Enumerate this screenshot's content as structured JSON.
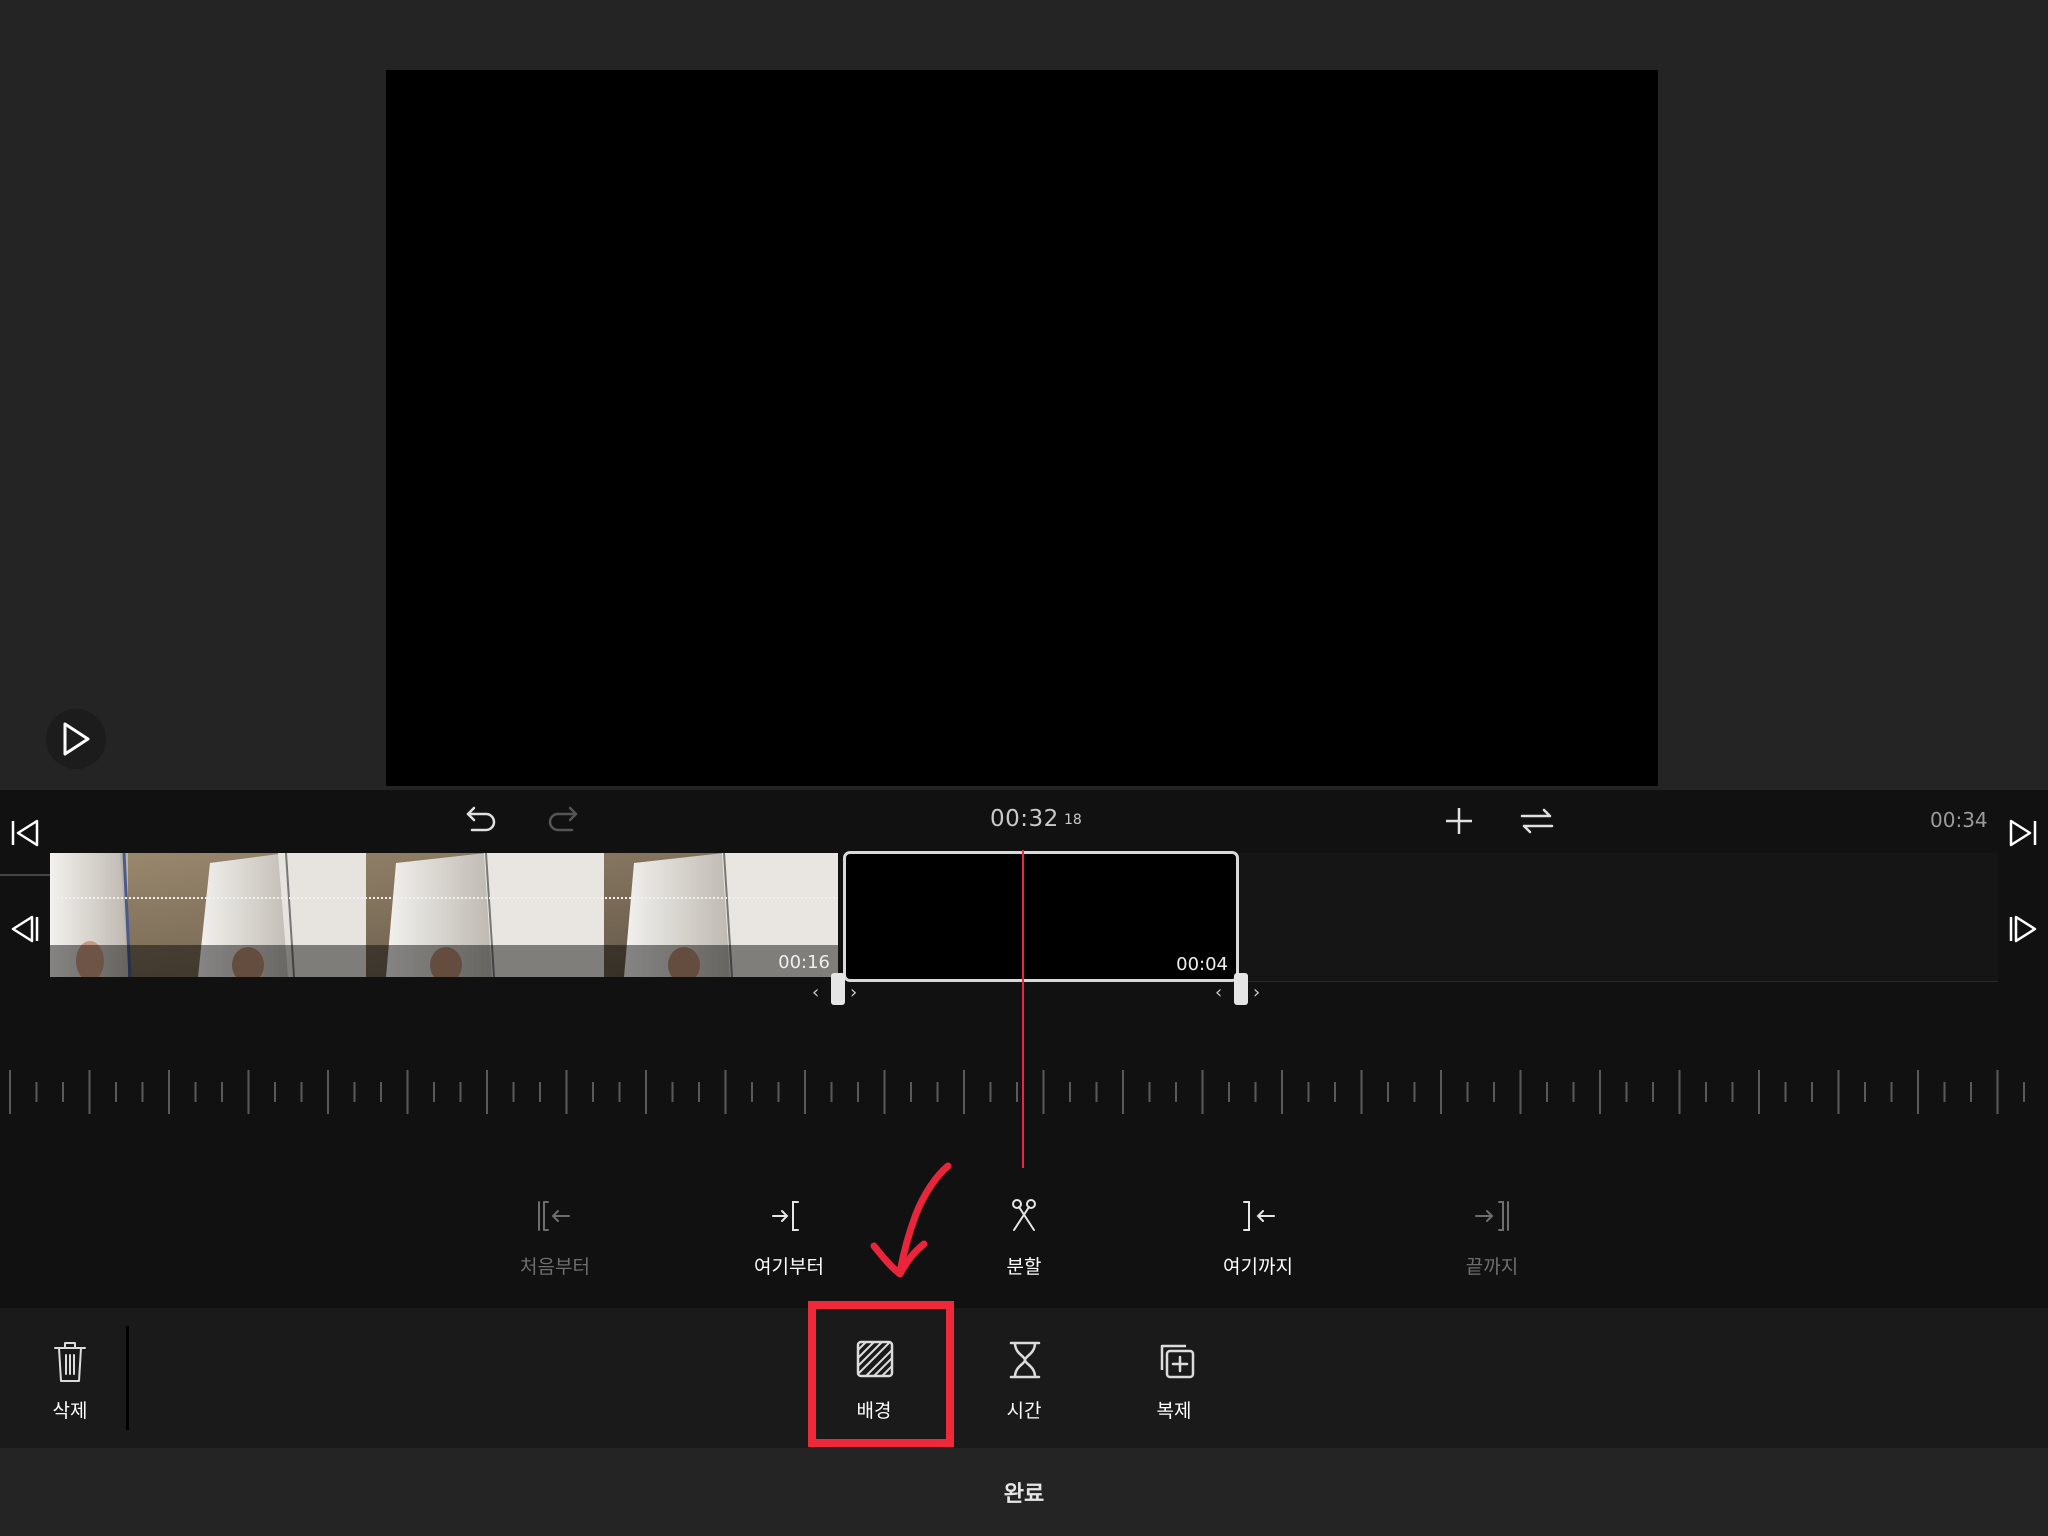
{
  "timecode": {
    "main": "00:32",
    "frame": "18",
    "total": "00:34"
  },
  "clips": [
    {
      "duration": "00:16"
    },
    {
      "duration": "00:04"
    }
  ],
  "edit_tools": [
    {
      "label": "처음부터",
      "enabled": false
    },
    {
      "label": "여기부터",
      "enabled": true
    },
    {
      "label": "분할",
      "enabled": true
    },
    {
      "label": "여기까지",
      "enabled": true
    },
    {
      "label": "끝까지",
      "enabled": false
    }
  ],
  "bottom_tools": {
    "delete": "삭제",
    "background": "배경",
    "time": "시간",
    "duplicate": "복제"
  },
  "done_label": "완료",
  "colors": {
    "accent": "#ee2a3a",
    "playhead": "#e8284b"
  }
}
